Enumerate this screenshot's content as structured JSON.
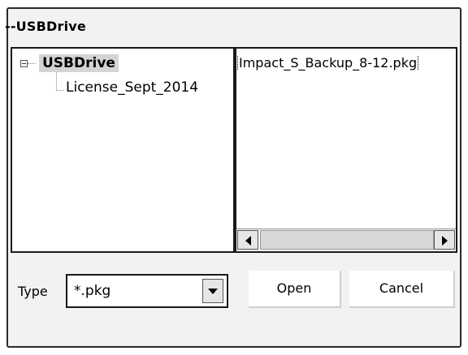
{
  "dialog": {
    "title": "--USBDrive"
  },
  "tree": {
    "root": "USBDrive",
    "children": [
      "License_Sept_2014"
    ]
  },
  "files": {
    "items": [
      "Impact_S_Backup_8-12.pkg"
    ]
  },
  "type_selector": {
    "label": "Type",
    "value": "*.pkg"
  },
  "buttons": {
    "open": "Open",
    "cancel": "Cancel"
  }
}
